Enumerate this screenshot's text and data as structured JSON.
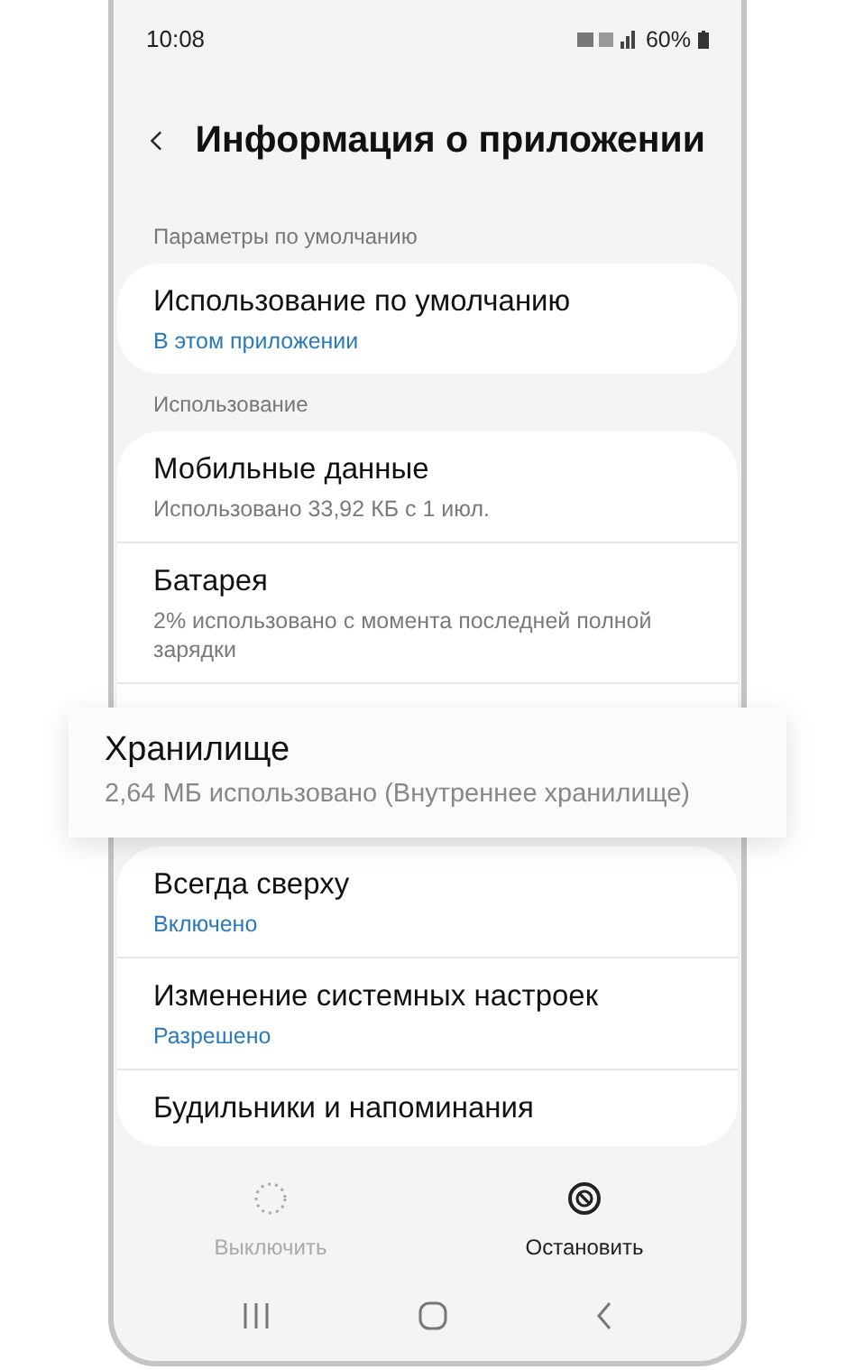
{
  "status_bar": {
    "time": "10:08",
    "battery": "60%"
  },
  "header": {
    "title": "Информация о приложении"
  },
  "sections": [
    {
      "header": "Параметры по умолчанию",
      "items": [
        {
          "title": "Использование по умолчанию",
          "subtitle": "В этом приложении",
          "kind": "status"
        }
      ]
    },
    {
      "header": "Использование",
      "items": [
        {
          "title": "Мобильные данные",
          "subtitle": "Использовано 33,92 КБ с 1 июл.",
          "kind": "detail"
        },
        {
          "title": "Батарея",
          "subtitle": "2% использовано с момента последней полной зарядки",
          "kind": "detail"
        },
        {
          "kind": "covered"
        }
      ]
    },
    {
      "items": [
        {
          "title": "Всегда сверху",
          "subtitle": "Включено",
          "kind": "status"
        },
        {
          "title": "Изменение системных настроек",
          "subtitle": "Разрешено",
          "kind": "status"
        },
        {
          "title": "Будильники и напоминания",
          "kind": "status"
        }
      ]
    }
  ],
  "highlight": {
    "title": "Хранилище",
    "subtitle": "2,64 МБ использовано (Внутреннее хранилище)"
  },
  "actions": [
    {
      "label": "Выключить",
      "disabled": true,
      "kind": "disable"
    },
    {
      "label": "Остановить",
      "disabled": false,
      "kind": "stop"
    }
  ]
}
